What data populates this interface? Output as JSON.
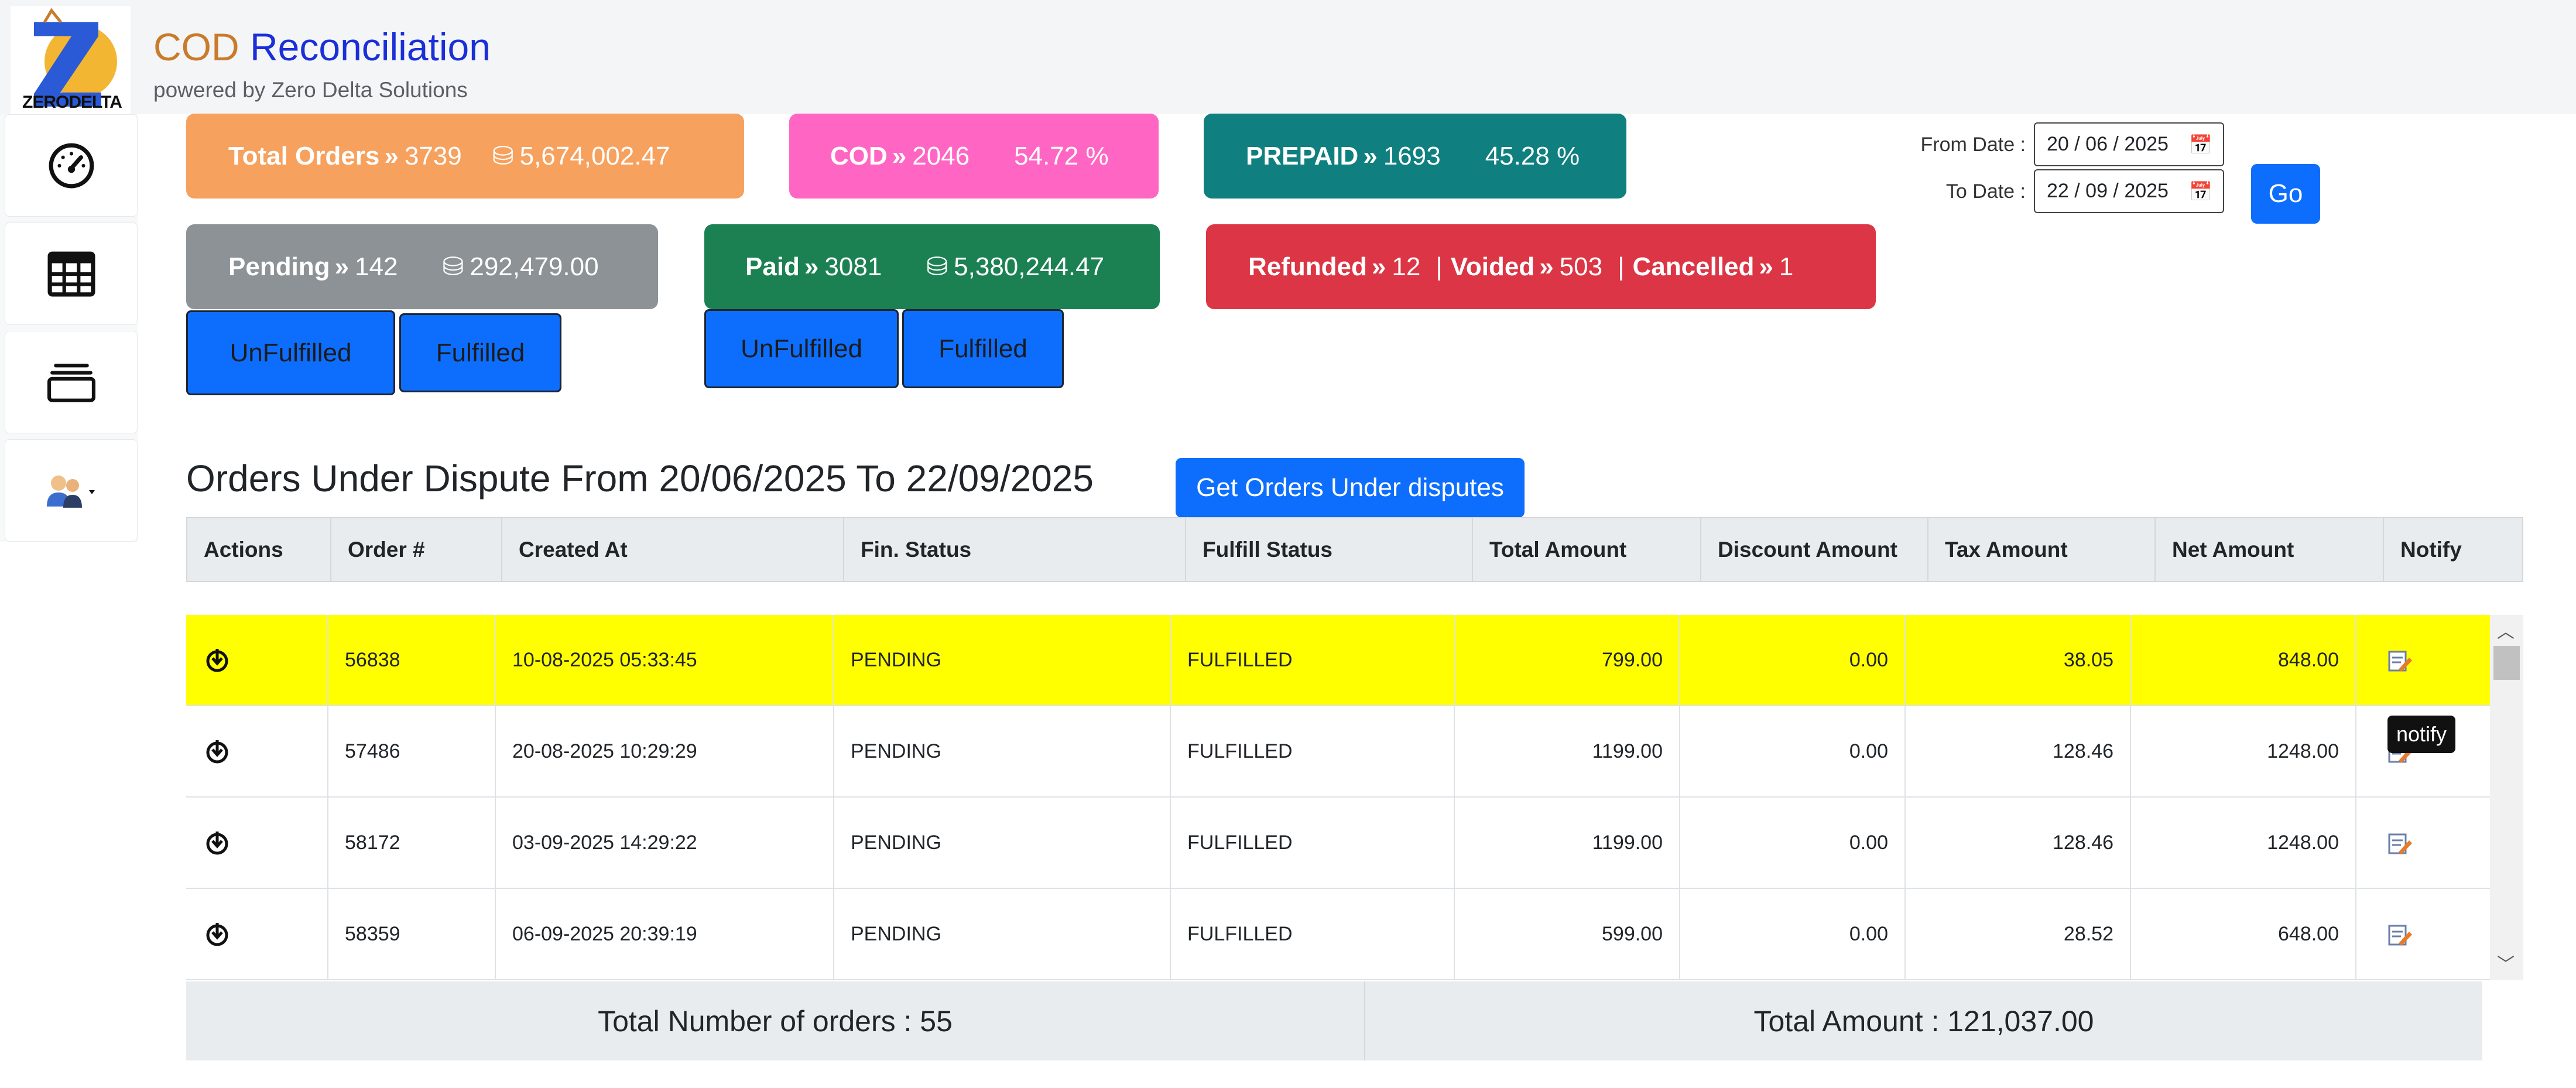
{
  "app": {
    "title_part1": "COD",
    "title_part2": "Reconciliation",
    "subtitle": "powered by Zero Delta Solutions",
    "logo_text": "ZERODELTA"
  },
  "sidebar": {
    "items": [
      {
        "icon": "dashboard-gauge-icon"
      },
      {
        "icon": "table-grid-icon"
      },
      {
        "icon": "stack-icon"
      },
      {
        "icon": "users-dropdown-icon"
      }
    ]
  },
  "stats": {
    "total_orders": {
      "label": "Total Orders",
      "count": "3739",
      "amount": "5,674,002.47",
      "color": "#f6a15e"
    },
    "cod": {
      "label": "COD",
      "count": "2046",
      "percent": "54.72 %",
      "color": "#ff66c4"
    },
    "prepaid": {
      "label": "PREPAID",
      "count": "1693",
      "percent": "45.28 %",
      "color": "#0f7f7f"
    },
    "pending": {
      "label": "Pending",
      "count": "142",
      "amount": "292,479.00",
      "color": "#8c9296"
    },
    "paid": {
      "label": "Paid",
      "count": "3081",
      "amount": "5,380,244.47",
      "color": "#1b8152"
    },
    "refunded": {
      "label": "Refunded",
      "count": "12",
      "voided_label": "Voided",
      "voided_count": "503",
      "cancelled_label": "Cancelled",
      "cancelled_count": "1",
      "color": "#dc3545"
    }
  },
  "fulfil_buttons": {
    "pending_unfulfilled": "UnFulfilled",
    "pending_fulfilled": "Fulfilled",
    "paid_unfulfilled": "UnFulfilled",
    "paid_fulfilled": "Fulfilled"
  },
  "dates": {
    "from_label": "From Date :",
    "from_value": "20 / 06 / 2025",
    "to_label": "To Date :",
    "to_value": "22 / 09 / 2025",
    "go_label": "Go"
  },
  "dispute": {
    "title": "Orders Under Dispute From 20/06/2025 To 22/09/2025",
    "button_label": "Get Orders Under disputes"
  },
  "table": {
    "columns": [
      "Actions",
      "Order #",
      "Created At",
      "Fin. Status",
      "Fulfill Status",
      "Total Amount",
      "Discount Amount",
      "Tax Amount",
      "Net Amount",
      "Notify"
    ],
    "rows": [
      {
        "order": "56838",
        "created": "10-08-2025 05:33:45",
        "fin": "PENDING",
        "fulfill": "FULFILLED",
        "total": "799.00",
        "discount": "0.00",
        "tax": "38.05",
        "net": "848.00",
        "highlighted": true
      },
      {
        "order": "57486",
        "created": "20-08-2025 10:29:29",
        "fin": "PENDING",
        "fulfill": "FULFILLED",
        "total": "1199.00",
        "discount": "0.00",
        "tax": "128.46",
        "net": "1248.00",
        "highlighted": false
      },
      {
        "order": "58172",
        "created": "03-09-2025 14:29:22",
        "fin": "PENDING",
        "fulfill": "FULFILLED",
        "total": "1199.00",
        "discount": "0.00",
        "tax": "128.46",
        "net": "1248.00",
        "highlighted": false
      },
      {
        "order": "58359",
        "created": "06-09-2025 20:39:19",
        "fin": "PENDING",
        "fulfill": "FULFILLED",
        "total": "599.00",
        "discount": "0.00",
        "tax": "28.52",
        "net": "648.00",
        "highlighted": false
      }
    ],
    "tooltip": "notify"
  },
  "footer": {
    "total_orders": "Total Number of orders : 55",
    "total_amount": "Total Amount : 121,037.00"
  }
}
